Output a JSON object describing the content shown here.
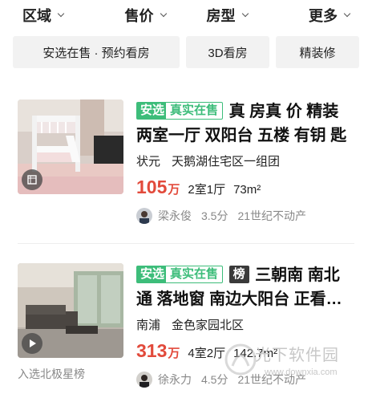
{
  "filters": [
    {
      "label": "区域"
    },
    {
      "label": "售价"
    },
    {
      "label": "房型"
    },
    {
      "label": "更多"
    }
  ],
  "quick_tags": [
    {
      "label": "安选在售 · 预约看房"
    },
    {
      "label": "3D看房"
    },
    {
      "label": "精装修"
    }
  ],
  "listings": [
    {
      "badges": [
        "安选",
        "真实在售"
      ],
      "title": "真 房真 价 精装 两室一厅 双阳台 五楼 有钥 匙",
      "district": "状元",
      "community": "天鹅湖住宅区一组团",
      "price": "105",
      "price_unit": "万",
      "rooms": "2室1厅",
      "area": "73m²",
      "agent": "梁永俊",
      "score": "3.5分",
      "company": "21世纪不动产",
      "thumb_icon": "vr-cube-icon"
    },
    {
      "badges": [
        "安选",
        "真实在售",
        "榜"
      ],
      "title": "三朝南 南北 通 落地窗 南边大阳台 正看…",
      "district": "南浦",
      "community": "金色家园北区",
      "price": "313",
      "price_unit": "万",
      "rooms": "4室2厅",
      "area": "142.7m²",
      "agent": "徐永力",
      "score": "4.5分",
      "company": "21世纪不动产",
      "thumb_icon": "play-icon",
      "rank_note": "入选北极星榜"
    }
  ],
  "watermark": {
    "text": "光下软件园",
    "url": "www.downxia.com"
  },
  "colors": {
    "accent_green": "#3dbd7a",
    "price_red": "#e24a3b"
  }
}
